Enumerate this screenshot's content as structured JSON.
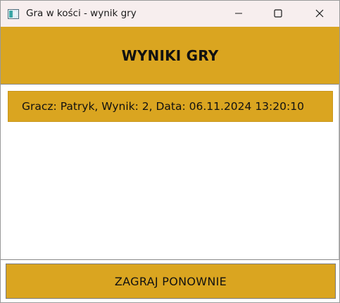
{
  "window": {
    "title": "Gra w kości - wynik gry",
    "icon": "window-app-icon",
    "controls": [
      "minimize-icon",
      "maximize-icon",
      "close-icon"
    ]
  },
  "header": {
    "title": "WYNIKI GRY"
  },
  "results": {
    "items": [
      {
        "text": "Gracz: Patryk, Wynik: 2, Data: 06.11.2024 13:20:10"
      }
    ]
  },
  "actions": {
    "play_again_label": "ZAGRAJ PONOWNIE"
  },
  "colors": {
    "accent": "#daa520",
    "titlebar": "#f7eeee",
    "text": "#111111"
  }
}
